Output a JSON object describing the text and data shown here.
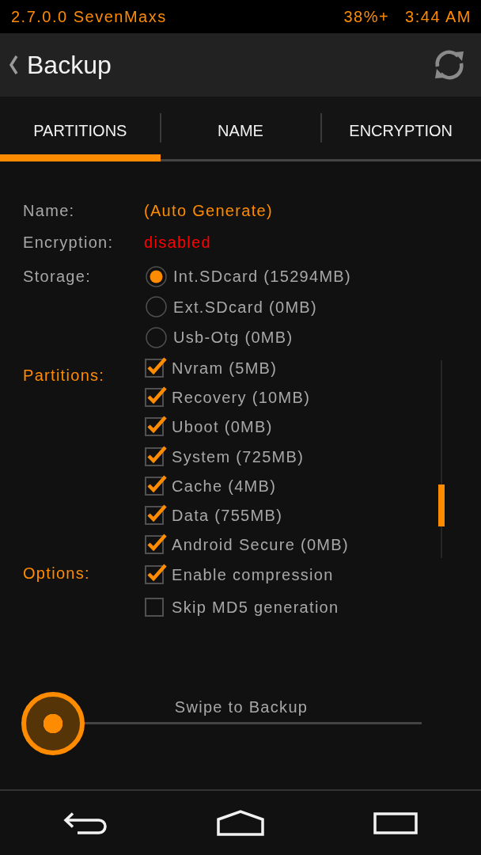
{
  "status_bar": {
    "version": "2.7.0.0 SevenMaxs",
    "battery": "38%+",
    "time": "3:44 AM"
  },
  "header": {
    "title": "Backup"
  },
  "tabs": [
    {
      "label": "PARTITIONS",
      "selected": true
    },
    {
      "label": "NAME",
      "selected": false
    },
    {
      "label": "ENCRYPTION",
      "selected": false
    }
  ],
  "details": [
    {
      "label": "Name:",
      "value": "(Auto Generate)",
      "color": "#ff8c00"
    },
    {
      "label": "Encryption:",
      "value": "disabled",
      "color": "#ff0000"
    }
  ],
  "storage": {
    "label": "Storage:",
    "options": [
      {
        "label": "Int.SDcard (15294MB)",
        "selected": true
      },
      {
        "label": "Ext.SDcard (0MB)",
        "selected": false
      },
      {
        "label": "Usb-Otg (0MB)",
        "selected": false
      }
    ]
  },
  "partitions": {
    "label": "Partitions:",
    "items": [
      {
        "label": "Nvram (5MB)",
        "checked": true
      },
      {
        "label": "Recovery (10MB)",
        "checked": true
      },
      {
        "label": "Uboot (0MB)",
        "checked": true
      },
      {
        "label": "System (725MB)",
        "checked": true
      },
      {
        "label": "Cache (4MB)",
        "checked": true
      },
      {
        "label": "Data (755MB)",
        "checked": true
      },
      {
        "label": "Android Secure (0MB)",
        "checked": true
      }
    ]
  },
  "options": {
    "label": "Options:",
    "items": [
      {
        "label": "Enable compression",
        "checked": true
      },
      {
        "label": "Skip MD5 generation",
        "checked": false
      }
    ]
  },
  "swipe": {
    "label": "Swipe to Backup",
    "level": 0
  }
}
